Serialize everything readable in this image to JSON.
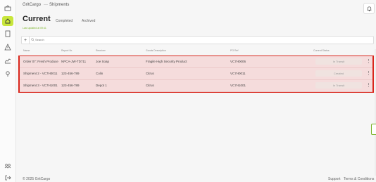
{
  "breadcrumb": {
    "app": "GritCargo",
    "page": "Shipments"
  },
  "page": {
    "title": "Current",
    "updated": "Last updated at 09:41"
  },
  "tabs": [
    {
      "label": "Completed"
    },
    {
      "label": "Archived"
    }
  ],
  "search": {
    "placeholder": "Search"
  },
  "table": {
    "headers": [
      "Name",
      "Report Nr.",
      "Receiver",
      "Goods Description",
      "PO Ref",
      "Current Status"
    ],
    "rows": [
      {
        "name": "Order 07: Fresh Produce",
        "report": "NPCA-JW-TD711",
        "receiver": "Joe Soap",
        "goods": "Fragile High Security Product",
        "po": "VC7H0006",
        "status": "In Transit"
      },
      {
        "name": "Shipment 2 - VC7H0011",
        "report": "123-456-789",
        "receiver": "Colin",
        "goods": "Citrus",
        "po": "VC7H0011",
        "status": "Created"
      },
      {
        "name": "Shipment 3 - VC7H1001",
        "report": "123-456-789",
        "receiver": "Depot 1",
        "goods": "Citrus",
        "po": "VC7H1001",
        "status": "In Transit"
      }
    ]
  },
  "footer": {
    "copyright": "© 2025 GritCargo",
    "support": "Support",
    "terms": "Terms & Conditions"
  },
  "colors": {
    "accent": "#c8e63c",
    "highlight": "#d9261c",
    "row_bg": "#f5dcdc"
  },
  "icons": {
    "sidebar": [
      "dashboard-icon",
      "home-icon",
      "document-icon",
      "alert-icon",
      "chart-icon",
      "location-icon",
      "team-icon",
      "logout-icon"
    ],
    "header": "bell-icon"
  }
}
